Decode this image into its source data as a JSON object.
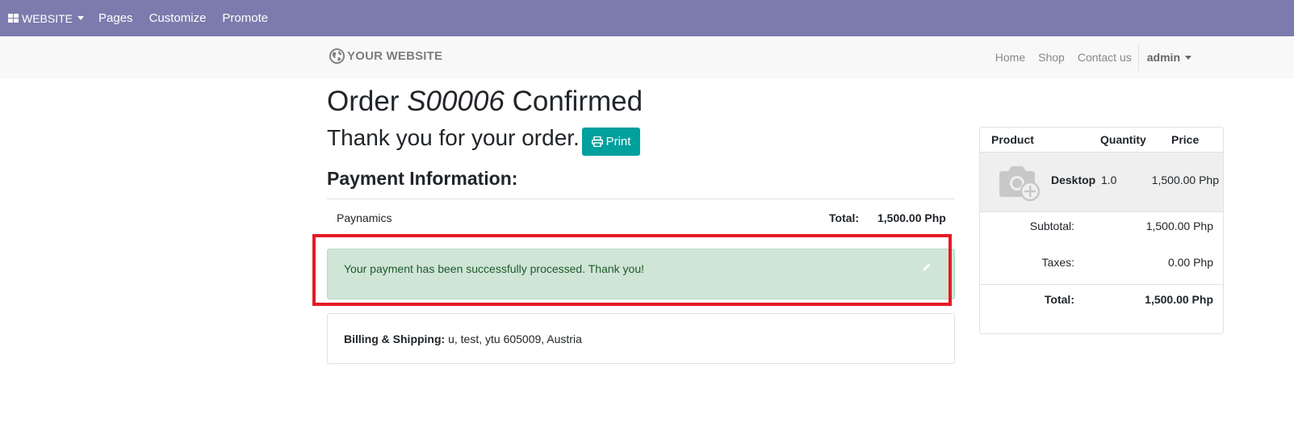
{
  "admin_bar": {
    "website_label": "WEBSITE",
    "pages_label": "Pages",
    "customize_label": "Customize",
    "promote_label": "Promote"
  },
  "header": {
    "logo_text": "YOUR WEBSITE",
    "nav": [
      "Home",
      "Shop",
      "Contact us"
    ],
    "user": "admin"
  },
  "order": {
    "title_prefix": "Order",
    "order_number": "S00006",
    "title_suffix": "Confirmed",
    "thank_you": "Thank you for your order.",
    "print_label": "Print"
  },
  "payment": {
    "heading": "Payment Information:",
    "method": "Paynamics",
    "total_label": "Total:",
    "total_value": "1,500.00 Php",
    "status_message": "Your payment has been successfully processed. Thank you!"
  },
  "billing": {
    "label": "Billing & Shipping:",
    "address": "u, test, ytu 605009, Austria"
  },
  "summary": {
    "col_product": "Product",
    "col_quantity": "Quantity",
    "col_price": "Price",
    "item_name": "Desktop",
    "item_qty": "1.0",
    "item_price": "1,500.00 Php",
    "subtotal_label": "Subtotal:",
    "subtotal_value": "1,500.00 Php",
    "taxes_label": "Taxes:",
    "taxes_value": "0.00 Php",
    "total_label": "Total:",
    "total_value": "1,500.00 Php"
  },
  "colors": {
    "admin_bar_bg": "#7c7bad",
    "primary_button": "#00a09d",
    "alert_success_bg": "#cfe5d6",
    "highlight_border": "#e51b24"
  }
}
